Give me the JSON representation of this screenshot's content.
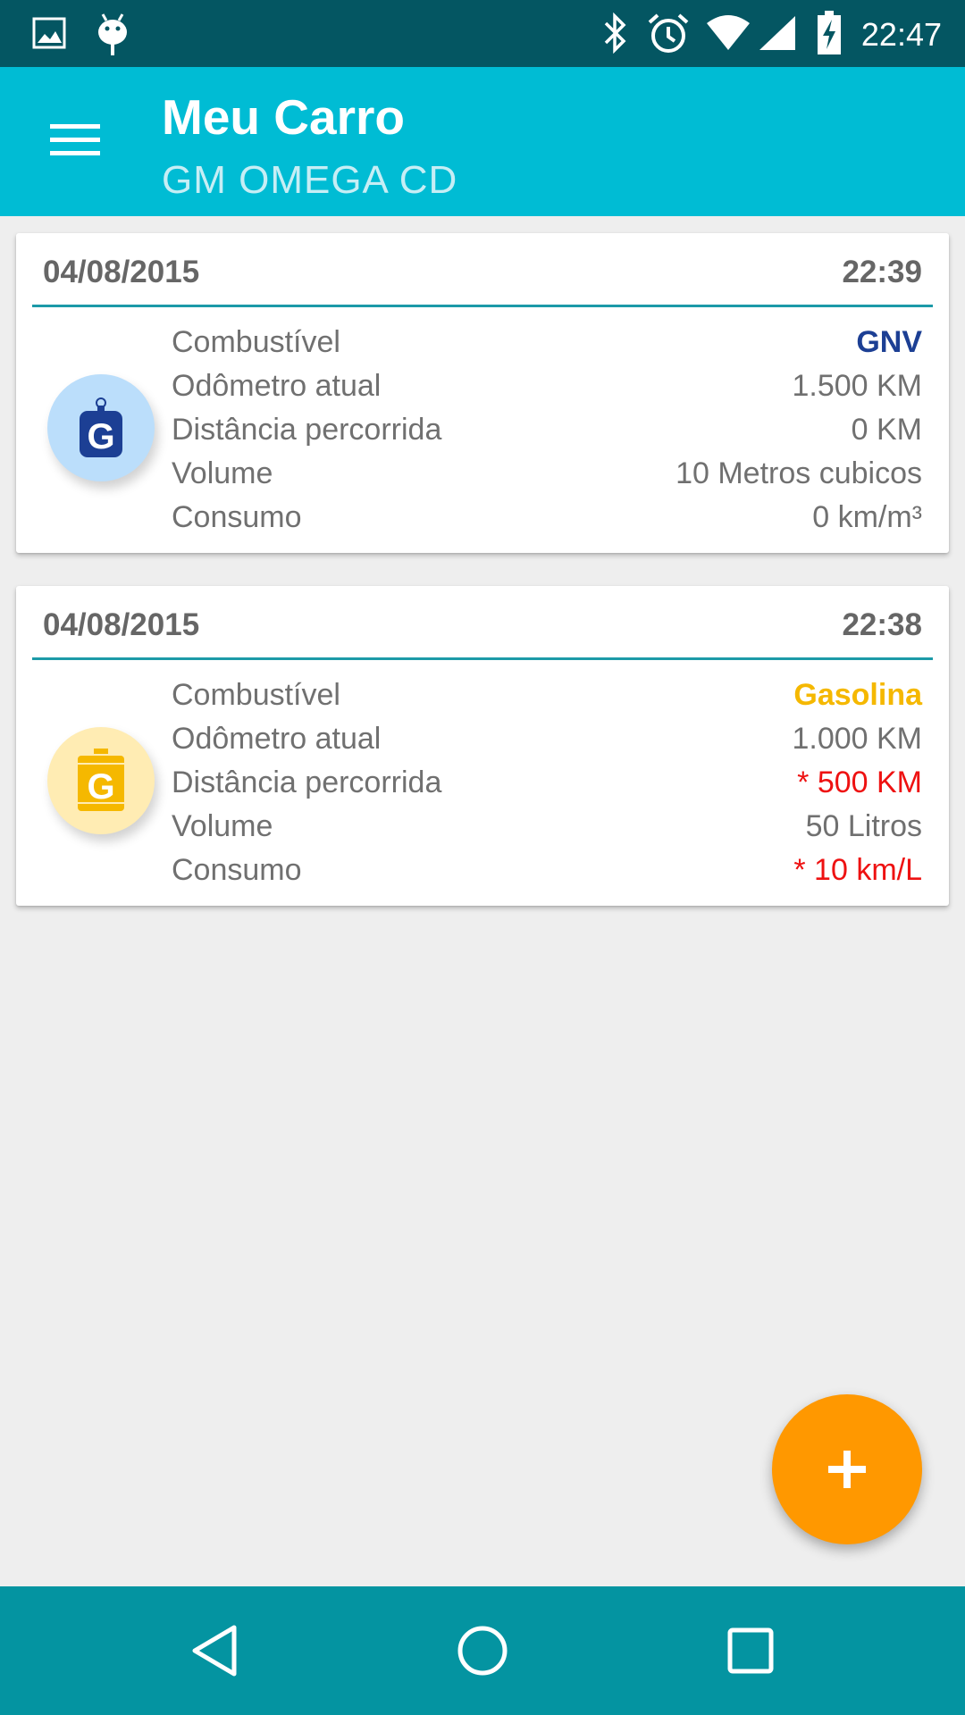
{
  "status_bar": {
    "time": "22:47",
    "icons": [
      "image-icon",
      "android-debug-icon",
      "bluetooth-icon",
      "alarm-icon",
      "wifi-icon",
      "signal-icon",
      "battery-charging-icon"
    ]
  },
  "app_bar": {
    "title": "Meu Carro",
    "subtitle": "GM OMEGA CD",
    "menu_icon": "menu-icon"
  },
  "entries": [
    {
      "date": "04/08/2015",
      "time": "22:39",
      "fuel_icon": "gnv-cylinder-icon",
      "rows": [
        {
          "label": "Combustível",
          "value": "GNV"
        },
        {
          "label": "Odômetro atual",
          "value": "1.500 KM"
        },
        {
          "label": "Distância percorrida",
          "value": "0 KM"
        },
        {
          "label": "Volume",
          "value": "10 Metros cubicos"
        },
        {
          "label": "Consumo",
          "value": "0 km/m³"
        }
      ]
    },
    {
      "date": "04/08/2015",
      "time": "22:38",
      "fuel_icon": "gasoline-canister-icon",
      "rows": [
        {
          "label": "Combustível",
          "value": "Gasolina"
        },
        {
          "label": "Odômetro atual",
          "value": "1.000 KM"
        },
        {
          "label": "Distância percorrida",
          "value": "* 500 KM"
        },
        {
          "label": "Volume",
          "value": "50 Litros"
        },
        {
          "label": "Consumo",
          "value": "* 10 km/L"
        }
      ]
    }
  ],
  "fab": {
    "icon": "plus-icon"
  },
  "nav_bar": {
    "icons": [
      "back-icon",
      "home-icon",
      "recents-icon"
    ]
  },
  "colors": {
    "status_bar": "#045662",
    "app_bar": "#00bcd4",
    "accent": "#ff9800",
    "gnv": "#1c3f94",
    "gasoline": "#f5b800",
    "warning": "#ee1111"
  }
}
